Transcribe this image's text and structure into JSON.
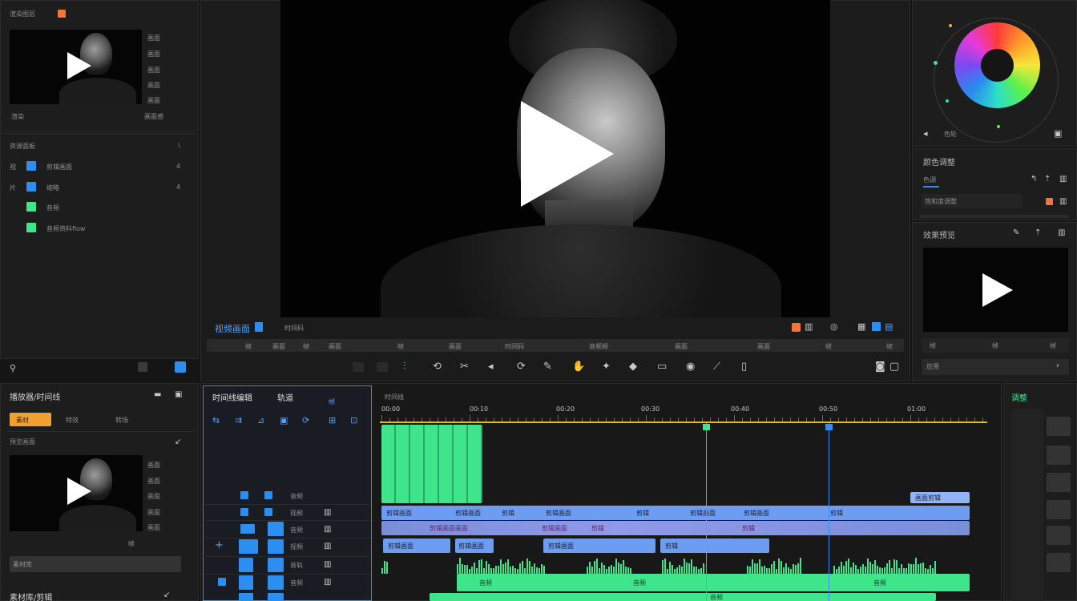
{
  "colors": {
    "accent_blue": "#2b8ef0",
    "accent_green": "#3ee58a",
    "accent_orange": "#f0763a",
    "playhead_orange": "#f07a3a",
    "playhead_blue": "#3a8af0",
    "ruler_yellow": "#e8b820"
  },
  "media_panel": {
    "title": "渲染图层",
    "thumb_props": [
      "画面",
      "画面",
      "画面",
      "画面",
      "画面"
    ],
    "footer_left": "渲染",
    "footer_right": "画面感",
    "list_header": "资源面板",
    "list_header_right": "\\",
    "items": [
      {
        "tag": "视",
        "label": "剪辑画面",
        "right": "4",
        "color": "#2b8ef0"
      },
      {
        "tag": "片",
        "label": "缩略",
        "right": "4",
        "color": "#2b8ef0"
      },
      {
        "tag": "",
        "label": "音频",
        "right": "",
        "color": "#3ee58a"
      },
      {
        "tag": "",
        "label": "音频资料flow",
        "right": "",
        "color": "#3ee58a"
      }
    ]
  },
  "viewer": {
    "play_icon": "play-icon",
    "bar_title": "视频画面",
    "bar_timecode": "时间码",
    "scrubber_labels": [
      "帧",
      "画面",
      "帧",
      "画面",
      "帧",
      "画面",
      "时间码",
      "音频频",
      "画面",
      "画面",
      "帧",
      "帧"
    ],
    "toolbar_icons": [
      "trim-icon",
      "ripple-icon",
      "razor-icon",
      "slip-icon",
      "slide-icon",
      "pen-icon",
      "hand-icon",
      "zoom-icon",
      "fx-icon",
      "color-icon",
      "curve-icon",
      "export-icon"
    ]
  },
  "color_panel": {
    "wheel_label": "色轮",
    "section_title": "颜色调整",
    "tab_label": "色调",
    "field_label": "饱和度调整",
    "preview_title": "效果预览",
    "preview_footer_left": "帧",
    "preview_footer_mid": "帧",
    "preview_footer_right": "帧",
    "apply_label": "应用"
  },
  "bottom_left": {
    "title": "播放器/时间线",
    "tabs": [
      "素材",
      "特效",
      "转场"
    ],
    "subtitle": "预览画面",
    "props": [
      "画面",
      "画面",
      "画面",
      "画面",
      "画面"
    ],
    "footer_right": "帧",
    "bar_label": "素材库",
    "footer_title": "素材库/剪辑"
  },
  "timeline": {
    "header_title": "时间线编辑",
    "header_right": "轨道",
    "header_tag": "帧",
    "top_label": "时间线",
    "ruler_labels": [
      "00:00",
      "00:10",
      "00:20",
      "00:30",
      "00:40",
      "00:50",
      "01:00"
    ],
    "track_headers": [
      "音频",
      "视频",
      "音频",
      "视频",
      "音轨",
      "音频"
    ],
    "clips_v1": [
      "剪辑画面",
      "剪辑画面",
      "剪辑",
      "剪辑画面",
      "剪辑",
      "剪辑画面",
      "剪辑画面",
      "剪辑"
    ],
    "clips_v2": [
      "剪辑画面画面",
      "剪辑画面",
      "剪辑",
      "剪辑"
    ],
    "clips_v3": [
      "剪辑画面",
      "剪辑画面",
      "剪辑画面",
      "剪辑"
    ],
    "overlay_clip": "画面剪辑",
    "audio_labels": [
      "音频",
      "音频",
      "音频",
      "音频"
    ],
    "right_panel_title": "调整"
  }
}
